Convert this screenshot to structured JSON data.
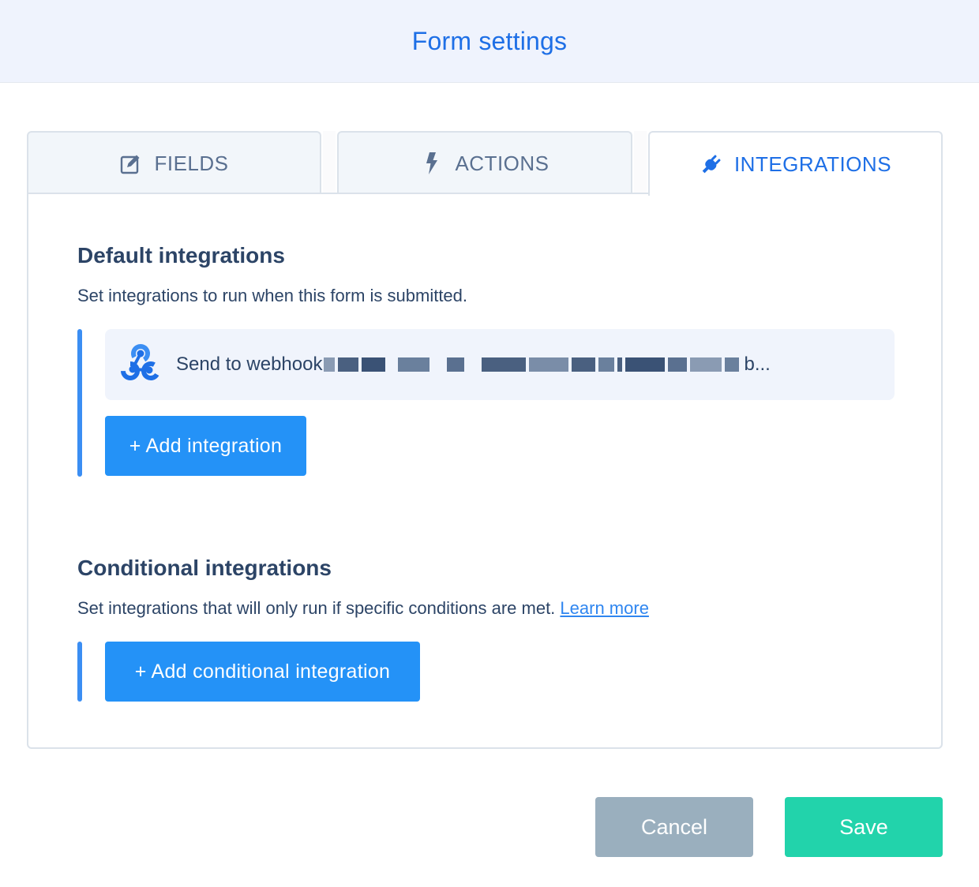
{
  "header": {
    "title": "Form settings"
  },
  "tabs": [
    {
      "label": "FIELDS",
      "icon": "edit-icon",
      "active": false
    },
    {
      "label": "ACTIONS",
      "icon": "bolt-icon",
      "active": false
    },
    {
      "label": "INTEGRATIONS",
      "icon": "plug-icon",
      "active": true
    }
  ],
  "default_integrations": {
    "title": "Default integrations",
    "description": "Set integrations to run when this form is submitted.",
    "items": [
      {
        "icon": "webhook-icon",
        "label": "Send to webhook",
        "value_redacted": true,
        "truncation": "b..."
      }
    ],
    "add_button": "+ Add integration"
  },
  "conditional_integrations": {
    "title": "Conditional integrations",
    "description": "Set integrations that will only run if specific conditions are met.",
    "learn_more": "Learn more",
    "add_button": "+ Add conditional integration"
  },
  "footer": {
    "cancel": "Cancel",
    "save": "Save"
  },
  "colors": {
    "accent": "#1e6fe6",
    "primary_button": "#2492f7",
    "save": "#22d3ab",
    "cancel": "#9aafbe",
    "header_bg": "#eff3fd",
    "text": "#2c4466"
  }
}
